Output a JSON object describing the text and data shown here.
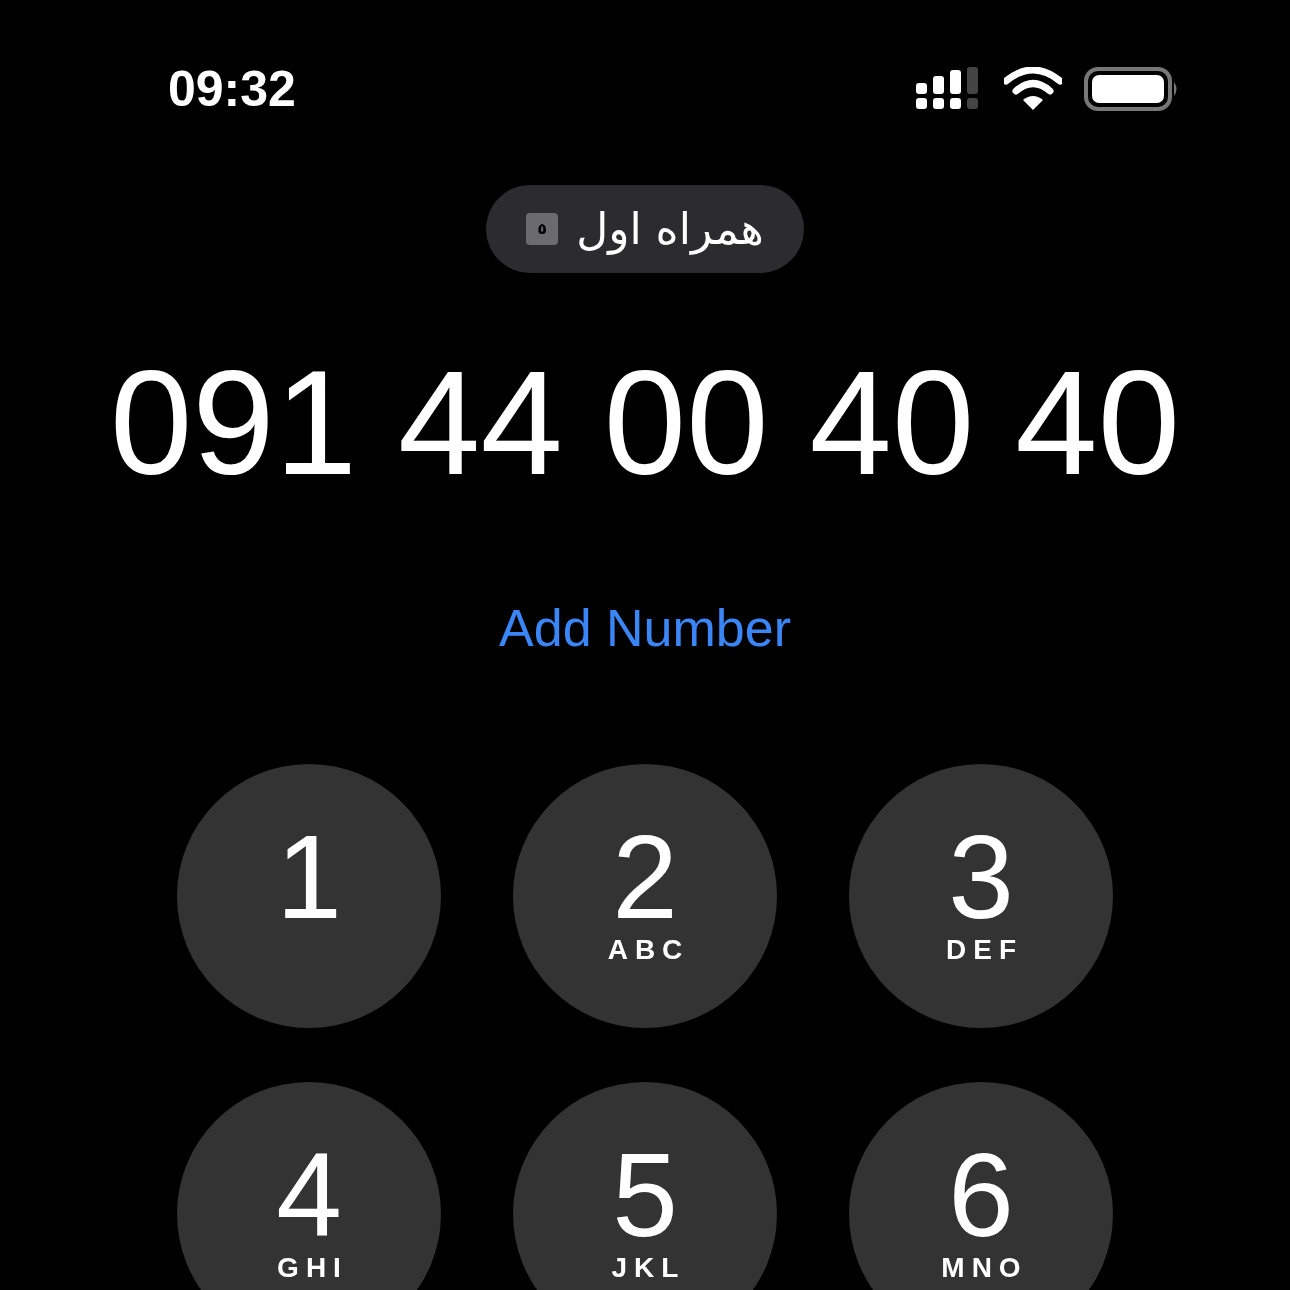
{
  "status_bar": {
    "time": "09:32"
  },
  "carrier": {
    "sim_badge": "٥",
    "name": "همراه اول"
  },
  "dialed_number": "091 44 00 40 40",
  "add_number_link": "Add Number",
  "keypad": [
    {
      "digit": "1"
    },
    {
      "digit": "2",
      "letters": "ABC"
    },
    {
      "digit": "3",
      "letters": "DEF"
    },
    {
      "digit": "4",
      "letters": "GHI"
    },
    {
      "digit": "5",
      "letters": "JKL"
    },
    {
      "digit": "6",
      "letters": "MNO"
    }
  ]
}
